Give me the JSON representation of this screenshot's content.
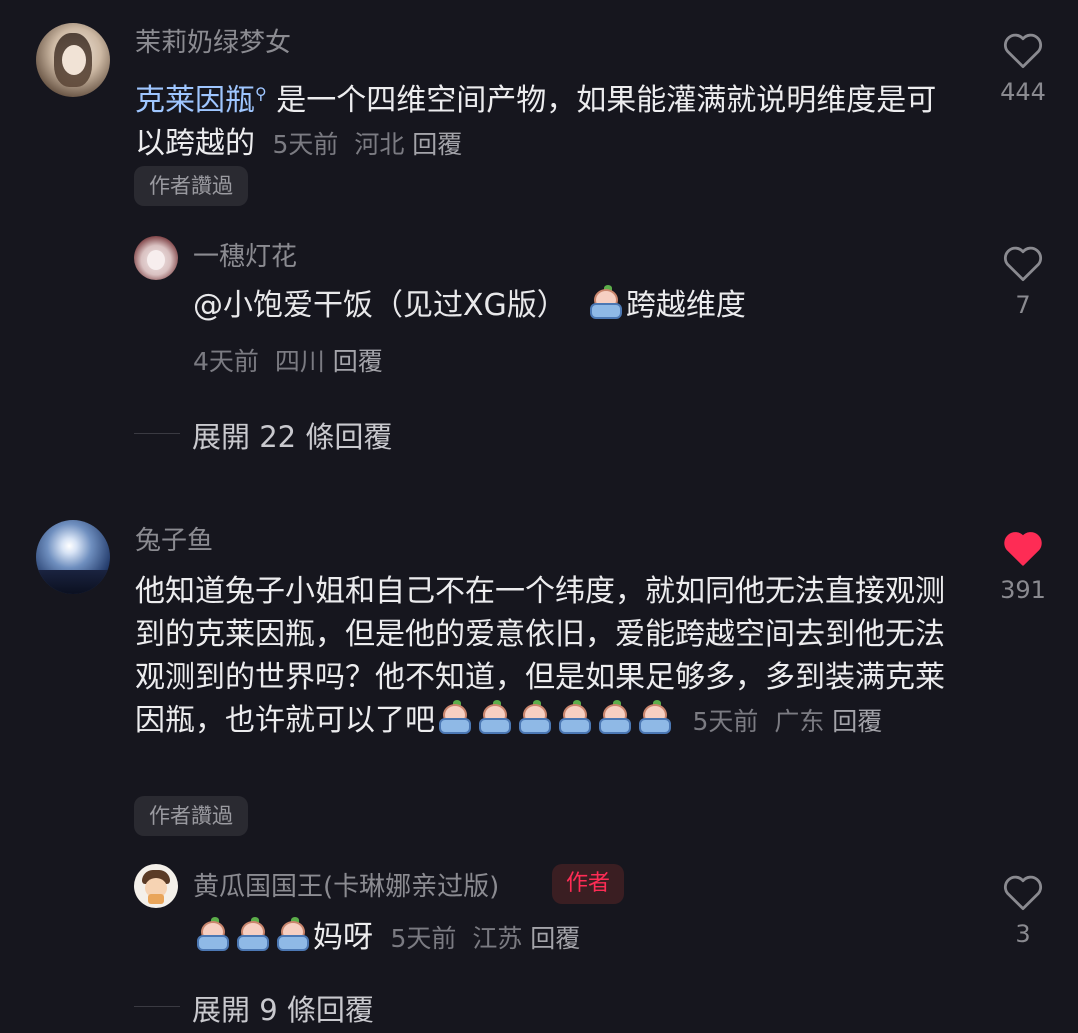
{
  "comments": [
    {
      "username": "茉莉奶绿梦女",
      "text_link": "克莱因瓶",
      "text_rest": "是一个四维空间产物，如果能灌满就说明维度是可以跨越的",
      "time": "5天前",
      "location": "河北",
      "reply_label": "回覆",
      "tag": "作者讚過",
      "likes": "444",
      "liked": false,
      "replies": [
        {
          "username": "一穗灯花",
          "text_before": "@小饱爱干饭（见过XG版）",
          "text_after": "跨越维度",
          "time": "4天前",
          "location": "四川",
          "reply_label": "回覆",
          "likes": "7"
        }
      ],
      "expand_label": "展開 22 條回覆"
    },
    {
      "username": "兔子鱼",
      "text": "他知道兔子小姐和自己不在一个纬度，就如同他无法直接观测到的克莱因瓶，但是他的爱意依旧，爱能跨越空间去到他无法观测到的世界吗？他不知道，但是如果足够多，多到装满克莱因瓶，也许就可以了吧",
      "time": "5天前",
      "location": "广东",
      "reply_label": "回覆",
      "tag": "作者讚過",
      "likes": "391",
      "liked": true,
      "replies": [
        {
          "username": "黄瓜国国王(卡琳娜亲过版)",
          "badge": "作者",
          "text": "妈呀",
          "time": "5天前",
          "location": "江苏",
          "reply_label": "回覆",
          "likes": "3"
        }
      ],
      "expand_label": "展開 9 條回覆"
    }
  ],
  "colors": {
    "background": "#16161e",
    "like_active": "#fe2c55",
    "link": "#9fc6ff"
  },
  "icons": [
    "heart-outline-icon",
    "heart-filled-icon",
    "search-icon",
    "crying-emoji"
  ]
}
